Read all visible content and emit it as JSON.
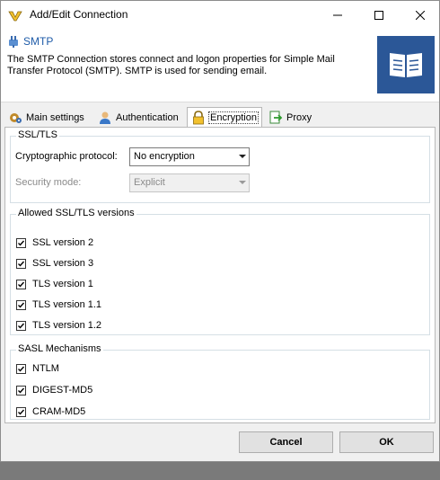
{
  "window": {
    "title": "Add/Edit Connection"
  },
  "header": {
    "title": "SMTP",
    "description": "The SMTP Connection stores connect and logon properties for Simple Mail Transfer Protocol (SMTP). SMTP is used for sending email."
  },
  "tabs": [
    {
      "label": "Main settings",
      "icon": "gear-icon"
    },
    {
      "label": "Authentication",
      "icon": "user-icon"
    },
    {
      "label": "Encryption",
      "icon": "lock-icon",
      "active": true
    },
    {
      "label": "Proxy",
      "icon": "proxy-icon"
    }
  ],
  "ssl_tls": {
    "legend": "SSL/TLS",
    "protocol_label": "Cryptographic protocol:",
    "protocol_value": "No encryption",
    "mode_label": "Security mode:",
    "mode_value": "Explicit"
  },
  "versions": {
    "legend": "Allowed SSL/TLS versions",
    "items": [
      {
        "label": "SSL version 2",
        "checked": true
      },
      {
        "label": "SSL version 3",
        "checked": true
      },
      {
        "label": "TLS version 1",
        "checked": true
      },
      {
        "label": "TLS version 1.1",
        "checked": true
      },
      {
        "label": "TLS version 1.2",
        "checked": true
      }
    ]
  },
  "sasl": {
    "legend": "SASL Mechanisms",
    "items": [
      {
        "label": "NTLM",
        "checked": true
      },
      {
        "label": "DIGEST-MD5",
        "checked": true
      },
      {
        "label": "CRAM-MD5",
        "checked": true
      }
    ]
  },
  "buttons": {
    "cancel": "Cancel",
    "ok": "OK"
  },
  "colors": {
    "accent": "#1e5ba8",
    "book_bg": "#2b5797"
  }
}
